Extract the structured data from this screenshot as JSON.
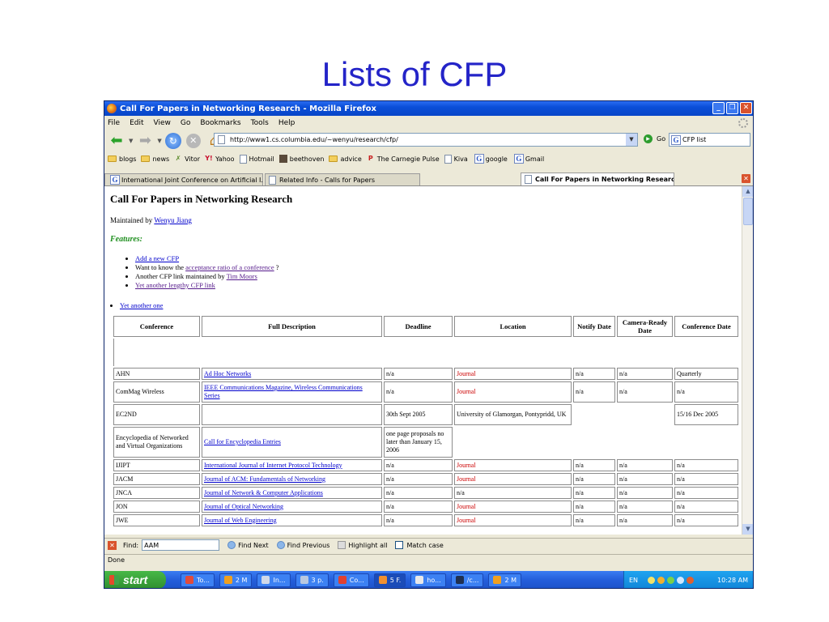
{
  "slide": {
    "title": "Lists of CFP"
  },
  "window": {
    "title": "Call For Papers in Networking Research - Mozilla Firefox",
    "controls": {
      "minimize": "_",
      "maximize": "❐",
      "close": "✕"
    }
  },
  "menu": [
    "File",
    "Edit",
    "View",
    "Go",
    "Bookmarks",
    "Tools",
    "Help"
  ],
  "nav": {
    "url": "http://www1.cs.columbia.edu/~wenyu/research/cfp/",
    "go_label": "Go",
    "search_value": "CFP list"
  },
  "bookmarks": [
    "blogs",
    "news",
    "Vitor",
    "Yahoo",
    "Hotmail",
    "beethoven",
    "advice",
    "The Carnegie Pulse",
    "Kiva",
    "google",
    "Gmail"
  ],
  "tabs": [
    {
      "label": "International Joint Conference on Artificial I..."
    },
    {
      "label": "Related Info - Calls for Papers"
    },
    {
      "label": "Call For Papers in Networking Research"
    }
  ],
  "page": {
    "heading": "Call For Papers in Networking Research",
    "maintained_prefix": "Maintained by ",
    "maintained_link": "Wenyu Jiang",
    "features_label": "Features:",
    "features": {
      "add_new": "Add a new CFP",
      "ratio_prefix": "Want to know the ",
      "ratio_link": "acceptance ratio of a conference",
      "ratio_suffix": " ?",
      "another_prefix": "Another CFP link maintained by ",
      "another_link": "Tim Moors",
      "lengthy": "Yet another lengthy CFP link"
    },
    "yet_another": "Yet another one"
  },
  "table": {
    "headers": [
      "Conference",
      "Full Description",
      "Deadline",
      "Location",
      "Notify Date",
      "Camera-Ready Date",
      "Conference Date"
    ],
    "rows": [
      {
        "conf": "AHN",
        "desc": "Ad Hoc Networks",
        "deadline": "n/a",
        "location": "Journal",
        "notify": "n/a",
        "camera": "n/a",
        "date": "Quarterly"
      },
      {
        "conf": "ComMag Wireless",
        "desc": "IEEE Communications Magazine, Wireless Communications Series",
        "deadline": "n/a",
        "location": "Journal",
        "notify": "n/a",
        "camera": "n/a",
        "date": "n/a"
      },
      {
        "conf": "EC2ND",
        "desc": "",
        "deadline": "30th Sept 2005",
        "location": "University of Glamorgan, Pontypridd, UK",
        "notify": "",
        "camera": "",
        "date": "15/16 Dec 2005"
      },
      {
        "conf": "Encyclopedia of Networked and Virtual Organizations",
        "desc": "Call for Encyclopedia Entries",
        "deadline": "one page proposals no later than January 15, 2006",
        "location": "",
        "notify": "",
        "camera": "",
        "date": ""
      },
      {
        "conf": "IJIPT",
        "desc": "International Journal of Internet Protocol Technology",
        "deadline": "n/a",
        "location": "Journal",
        "notify": "n/a",
        "camera": "n/a",
        "date": "n/a"
      },
      {
        "conf": "JACM",
        "desc": "Journal of ACM: Fundamentals of Networking",
        "deadline": "n/a",
        "location": "Journal",
        "notify": "n/a",
        "camera": "n/a",
        "date": "n/a"
      },
      {
        "conf": "JNCA",
        "desc": "Journal of Network & Computer Applications",
        "deadline": "n/a",
        "location": "n/a",
        "notify": "n/a",
        "camera": "n/a",
        "date": "n/a"
      },
      {
        "conf": "JON",
        "desc": "Journal of Optical Networking",
        "deadline": "n/a",
        "location": "Journal",
        "notify": "n/a",
        "camera": "n/a",
        "date": "n/a"
      },
      {
        "conf": "JWE",
        "desc": "Journal of Web Engineering",
        "deadline": "n/a",
        "location": "Journal",
        "notify": "n/a",
        "camera": "n/a",
        "date": "n/a"
      }
    ]
  },
  "findbar": {
    "label": "Find:",
    "value": "AAM",
    "next": "Find Next",
    "previous": "Find Previous",
    "highlight": "Highlight all",
    "match_case": "Match case"
  },
  "status": "Done",
  "taskbar": {
    "start": "start",
    "tasks": [
      "To...",
      "2 M",
      "In...",
      "3 p.",
      "Co...",
      "5 F.",
      "ho...",
      "/c...",
      "2 M"
    ],
    "lang": "EN",
    "clock": "10:28 AM"
  },
  "colors": {
    "title_blue": "#2424c8",
    "journal_red": "#cc0000",
    "link_blue": "#0000cc",
    "features_green": "#1f8f1f"
  }
}
